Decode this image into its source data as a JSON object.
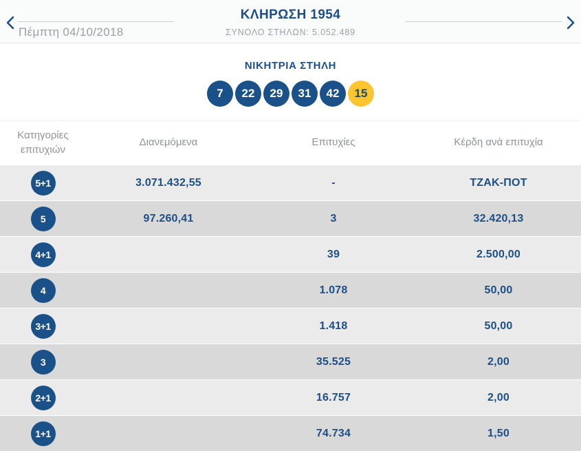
{
  "colors": {
    "navy": "#1C4F87",
    "ball_blue": "#1A5189",
    "joker_yellow": "#FDC52F",
    "row_light": "#EBEBEB",
    "row_dark": "#D9D9D9",
    "gray_text": "#8E9298"
  },
  "header": {
    "title": "ΚΛΗΡΩΣΗ 1954",
    "subtitle": "ΣΥΝΟΛΟ ΣΤΗΛΩΝ: 5.052.489",
    "date": "Πέμπτη 04/10/2018"
  },
  "winning_column": {
    "title": "ΝΙΚΗΤΡΙΑ ΣΤΗΛΗ",
    "numbers": [
      "7",
      "22",
      "29",
      "31",
      "42"
    ],
    "joker": "15"
  },
  "table": {
    "headers": [
      "Κατηγορίες επιτυχιών",
      "Διανεμόμενα",
      "Επιτυχίες",
      "Κέρδη ανά επιτυχία"
    ],
    "rows": [
      {
        "category": "5+1",
        "distributed": "3.071.432,55",
        "winners": "-",
        "prize": "ΤΖΑΚ-ΠΟΤ"
      },
      {
        "category": "5",
        "distributed": "97.260,41",
        "winners": "3",
        "prize": "32.420,13"
      },
      {
        "category": "4+1",
        "distributed": "",
        "winners": "39",
        "prize": "2.500,00"
      },
      {
        "category": "4",
        "distributed": "",
        "winners": "1.078",
        "prize": "50,00"
      },
      {
        "category": "3+1",
        "distributed": "",
        "winners": "1.418",
        "prize": "50,00"
      },
      {
        "category": "3",
        "distributed": "",
        "winners": "35.525",
        "prize": "2,00"
      },
      {
        "category": "2+1",
        "distributed": "",
        "winners": "16.757",
        "prize": "2,00"
      },
      {
        "category": "1+1",
        "distributed": "",
        "winners": "74.734",
        "prize": "1,50"
      }
    ]
  }
}
